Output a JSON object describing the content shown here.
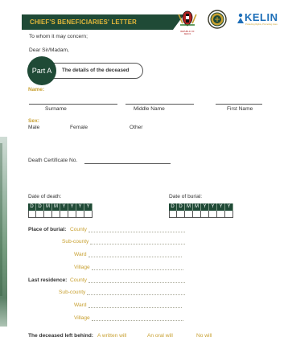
{
  "header": {
    "banner": "CHIEF'S BENEFICIARIES' LETTER",
    "seal_caption": "REPUBLIC OF KENYA",
    "brand": "KELIN",
    "tagline": "Protecting Rights, Promoting Lives"
  },
  "letter": {
    "greeting1": "To whom it may concern;",
    "greeting2": "Dear Sir/Madam,"
  },
  "part": {
    "label": "Part A",
    "title": "The details of the deceased"
  },
  "name": {
    "label": "Name:",
    "surname": "Surname",
    "middle": "Middle Name",
    "first": "First Name"
  },
  "sex": {
    "label": "Sex:",
    "male": "Male",
    "female": "Female",
    "other": "Other"
  },
  "death_cert": {
    "label": "Death Certificate No."
  },
  "dates": {
    "death_label": "Date of death:",
    "burial_label": "Date of burial:",
    "cells": [
      "D",
      "D",
      "M",
      "M",
      "Y",
      "Y",
      "Y",
      "Y"
    ]
  },
  "place_burial": {
    "label": "Place of burial:",
    "county": "County",
    "subcounty": "Sub-county",
    "ward": "Ward",
    "village": "Village"
  },
  "last_residence": {
    "label": "Last residence:",
    "county": "County",
    "subcounty": "Sub-county",
    "ward": "Ward",
    "village": "Village"
  },
  "left_behind": {
    "label": "The deceased left behind:",
    "written": "A written will",
    "oral": "An oral will",
    "none": "No will"
  },
  "colors": {
    "brand_green": "#1f4a36",
    "gold": "#c8a030"
  }
}
